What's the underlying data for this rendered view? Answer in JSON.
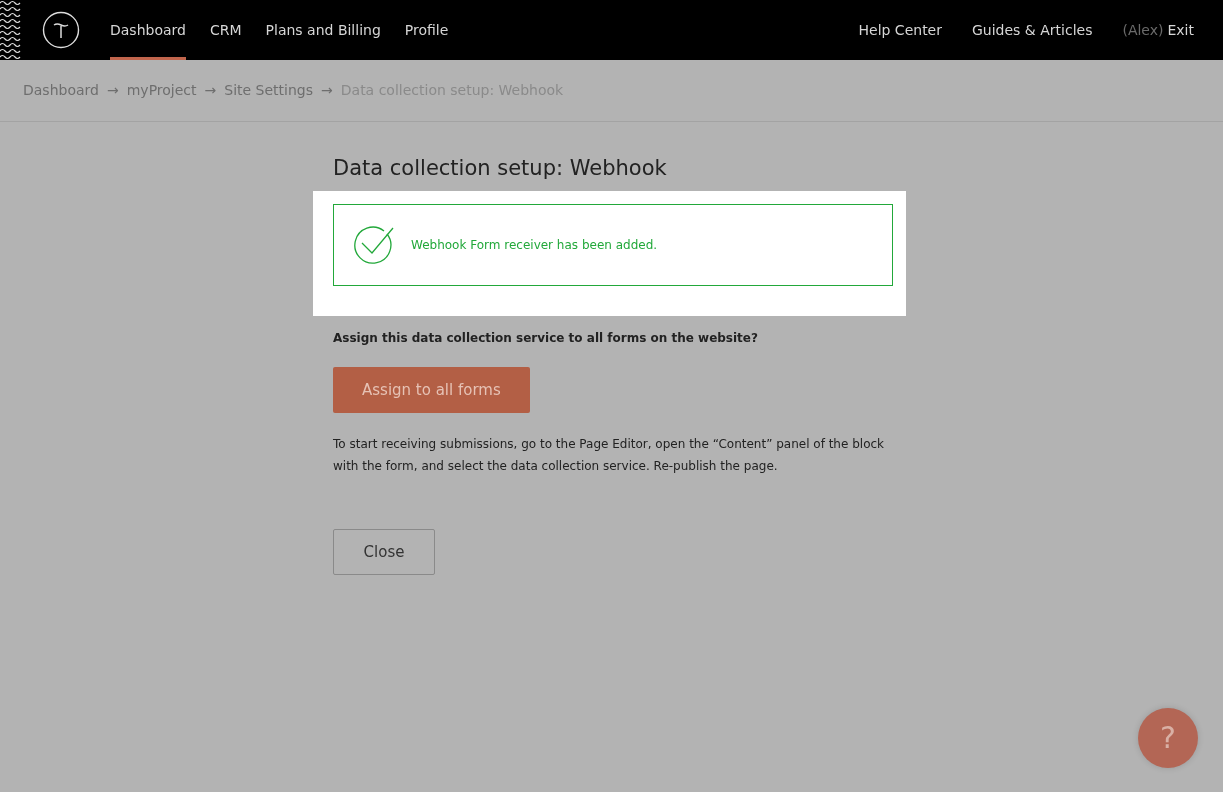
{
  "nav": {
    "items": [
      {
        "label": "Dashboard",
        "selected": true
      },
      {
        "label": "CRM",
        "selected": false
      },
      {
        "label": "Plans and Billing",
        "selected": false
      },
      {
        "label": "Profile",
        "selected": false
      }
    ],
    "right_links": [
      "Help Center",
      "Guides & Articles"
    ],
    "user": "(Alex)",
    "exit": "Exit"
  },
  "breadcrumb": [
    {
      "label": "Dashboard",
      "kind": "link"
    },
    {
      "label": "→",
      "kind": "separator"
    },
    {
      "label": "myProject",
      "kind": "link"
    },
    {
      "label": "→",
      "kind": "separator"
    },
    {
      "label": "Site Settings",
      "kind": "link"
    },
    {
      "label": "→",
      "kind": "separator"
    },
    {
      "label": "Data collection setup: Webhook",
      "kind": "current"
    }
  ],
  "title": "Data collection setup: Webhook",
  "alert": {
    "message": "Webhook Form receiver has been added."
  },
  "question": "Assign this data collection service to all forms on the website?",
  "assign_button": "Assign to all forms",
  "instructions": "To start receiving submissions, go to the Page Editor, open the “Content” panel of the block with the form, and select the data collection service. Re-publish the page.",
  "close_button": "Close",
  "help_button": "?"
}
